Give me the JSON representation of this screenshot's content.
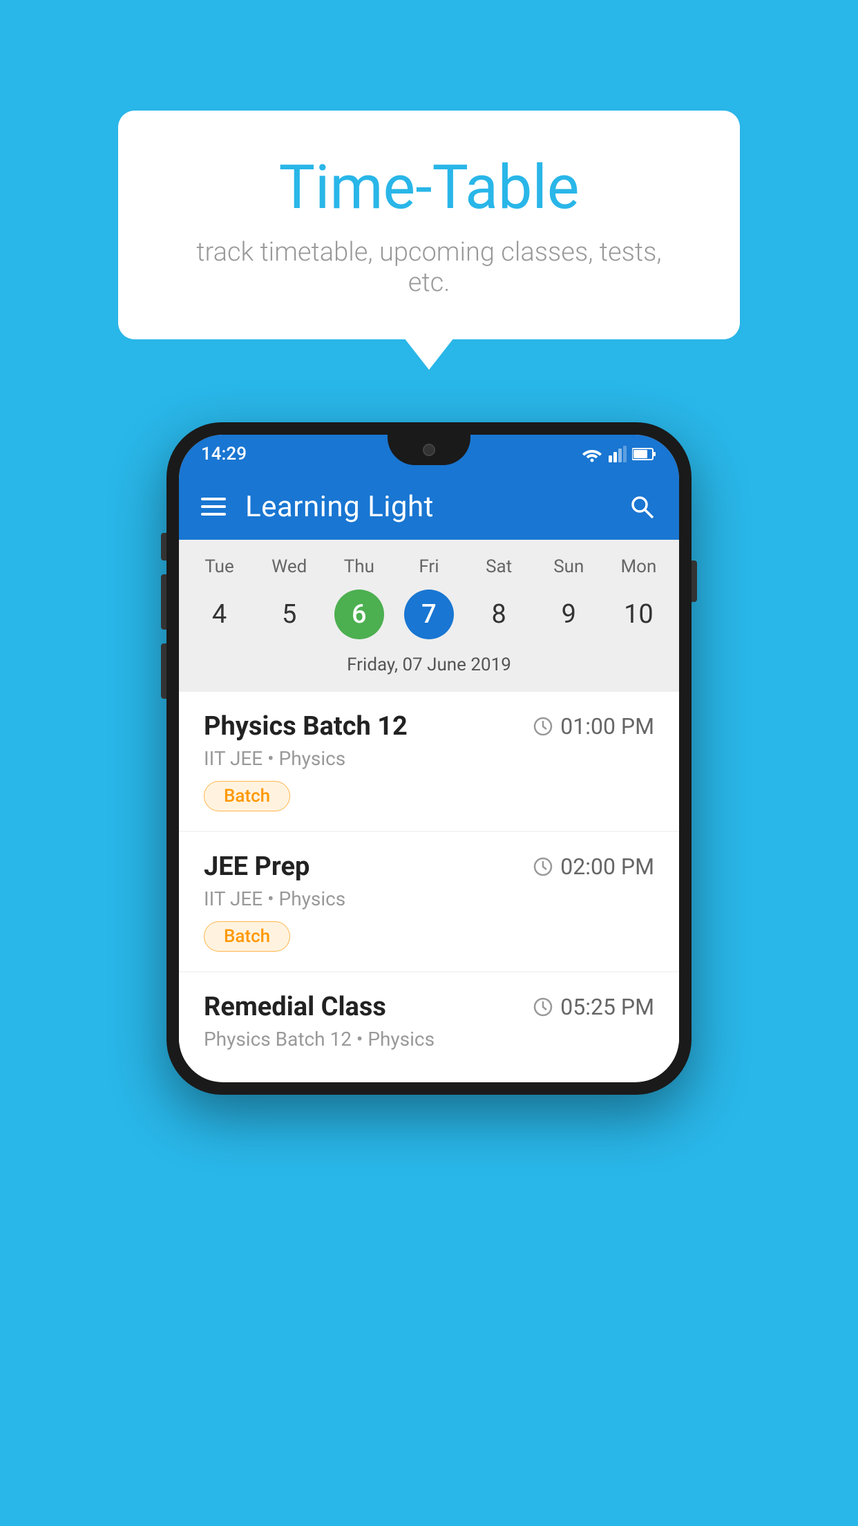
{
  "background_color": "#29B6E8",
  "bubble": {
    "title": "Time-Table",
    "subtitle": "track timetable, upcoming classes, tests, etc."
  },
  "phone": {
    "status_bar": {
      "time": "14:29"
    },
    "app_bar": {
      "title": "Learning Light"
    },
    "calendar": {
      "day_headers": [
        "Tue",
        "Wed",
        "Thu",
        "Fri",
        "Sat",
        "Sun",
        "Mon"
      ],
      "day_numbers": [
        "4",
        "5",
        "6",
        "7",
        "8",
        "9",
        "10"
      ],
      "today_index": 2,
      "selected_index": 3,
      "selected_date_label": "Friday, 07 June 2019"
    },
    "schedule": [
      {
        "name": "Physics Batch 12",
        "time": "01:00 PM",
        "sub": "IIT JEE • Physics",
        "badge": "Batch"
      },
      {
        "name": "JEE Prep",
        "time": "02:00 PM",
        "sub": "IIT JEE • Physics",
        "badge": "Batch"
      },
      {
        "name": "Remedial Class",
        "time": "05:25 PM",
        "sub": "Physics Batch 12 • Physics",
        "badge": null
      }
    ]
  }
}
